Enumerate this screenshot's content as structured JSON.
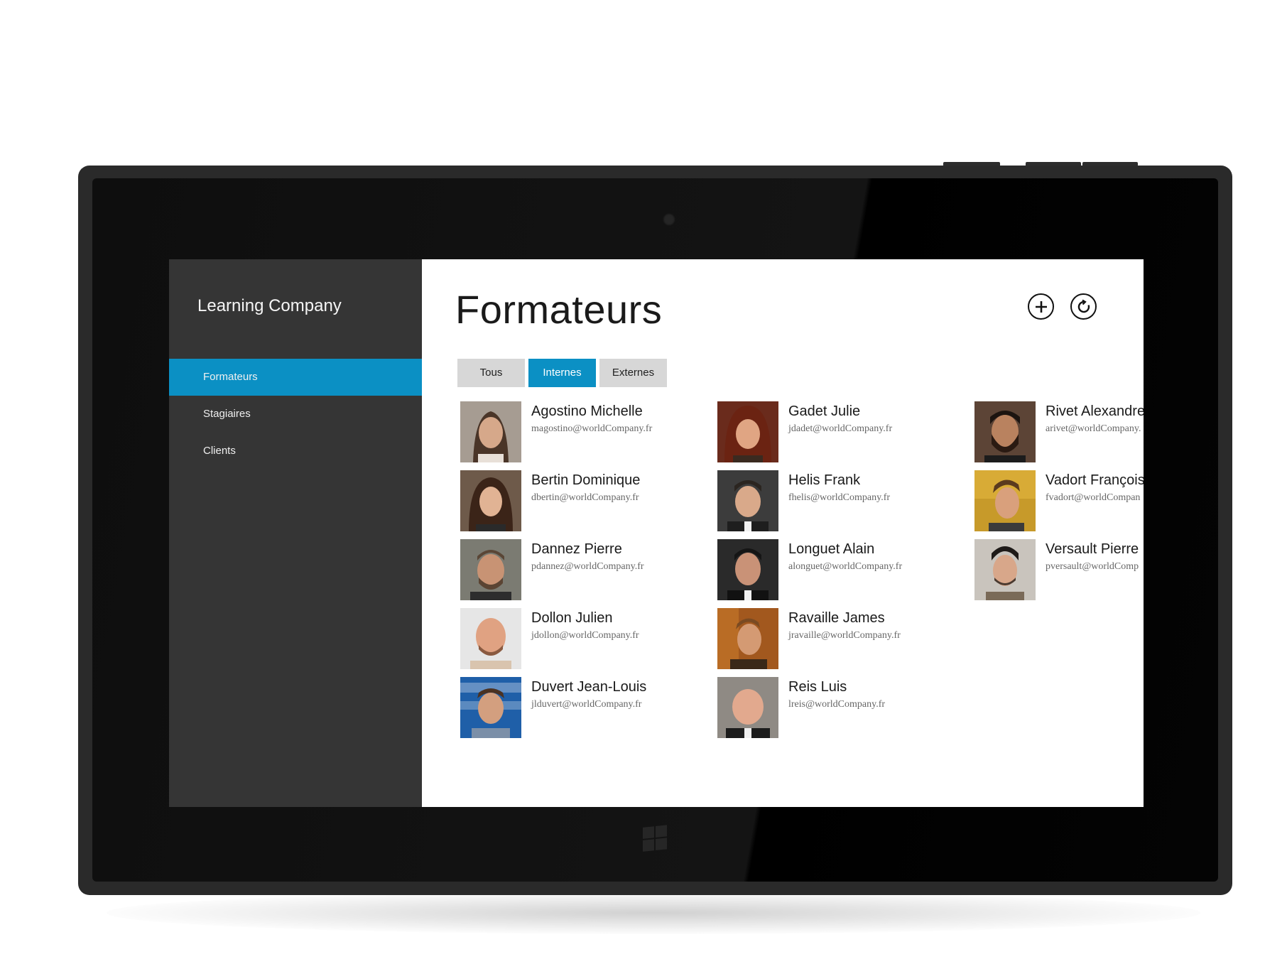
{
  "app": {
    "title": "Learning Company",
    "accent_color": "#0b90c4",
    "sidebar_color": "#353535"
  },
  "sidebar": {
    "items": [
      {
        "label": "Formateurs",
        "active": true
      },
      {
        "label": "Stagiaires",
        "active": false
      },
      {
        "label": "Clients",
        "active": false
      }
    ]
  },
  "main": {
    "title": "Formateurs",
    "actions": [
      {
        "icon": "add-icon"
      },
      {
        "icon": "refresh-icon"
      }
    ],
    "tabs": [
      {
        "label": "Tous",
        "active": false
      },
      {
        "label": "Internes",
        "active": true
      },
      {
        "label": "Externes",
        "active": false
      }
    ],
    "trainers": [
      {
        "name": "Agostino Michelle",
        "email": "magostino@worldCompany.fr"
      },
      {
        "name": "Bertin Dominique",
        "email": "dbertin@worldCompany.fr"
      },
      {
        "name": "Dannez Pierre",
        "email": "pdannez@worldCompany.fr"
      },
      {
        "name": "Dollon Julien",
        "email": "jdollon@worldCompany.fr"
      },
      {
        "name": "Duvert Jean-Louis",
        "email": "jlduvert@worldCompany.fr"
      },
      {
        "name": "Gadet Julie",
        "email": "jdadet@worldCompany.fr"
      },
      {
        "name": "Helis Frank",
        "email": "fhelis@worldCompany.fr"
      },
      {
        "name": "Longuet Alain",
        "email": "alonguet@worldCompany.fr"
      },
      {
        "name": "Ravaille James",
        "email": "jravaille@worldCompany.fr"
      },
      {
        "name": "Reis Luis",
        "email": "lreis@worldCompany.fr"
      },
      {
        "name": "Rivet Alexandre",
        "email": "arivet@worldCompany."
      },
      {
        "name": "Vadort François",
        "email": "fvadort@worldCompan"
      },
      {
        "name": "Versault Pierre",
        "email": "pversault@worldComp"
      }
    ]
  }
}
